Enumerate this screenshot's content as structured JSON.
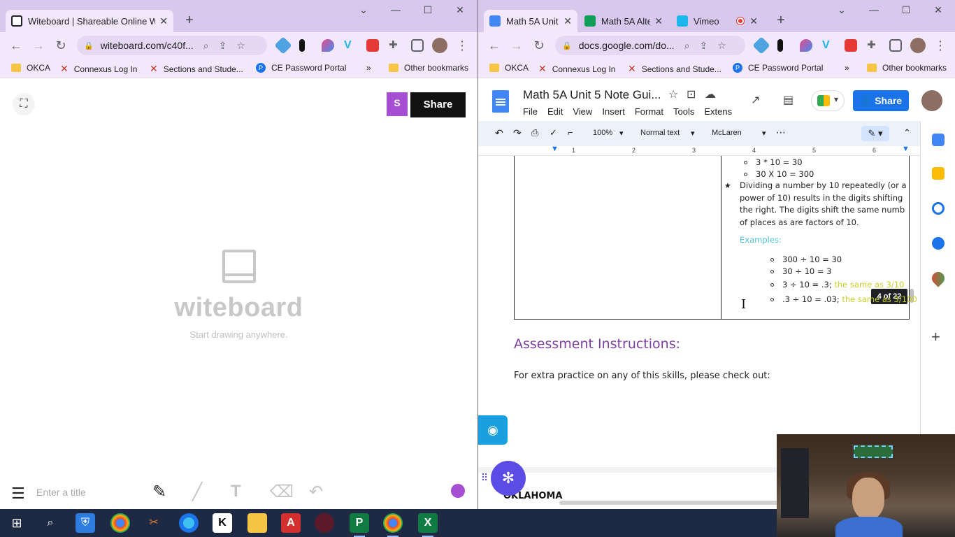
{
  "left_window": {
    "tab": {
      "title": "Witeboard | Shareable Online Wh",
      "close": "✕"
    },
    "new_tab": "+",
    "window_controls": {
      "chevron": "⌄",
      "minimize": "—",
      "maximize": "☐",
      "close": "✕"
    },
    "address": "witeboard.com/c40f...",
    "bookmarks": [
      "OKCA",
      "Connexus Log In",
      "Sections and Stude...",
      "CE Password Portal"
    ],
    "bookmarks_more": "»",
    "other_bookmarks": "Other bookmarks",
    "content": {
      "avatar_letter": "S",
      "share": "Share",
      "brand": "witeboard",
      "tagline": "Start drawing anywhere.",
      "title_placeholder": "Enter a title",
      "accent": "#a64fd2"
    }
  },
  "right_window": {
    "tabs": [
      {
        "title": "Math 5A Unit",
        "icon_color": "#4285f4"
      },
      {
        "title": "Math 5A Alte",
        "icon_color": "#0f9d58"
      },
      {
        "title": "Vimeo",
        "icon_color": "#1ab7ea"
      }
    ],
    "new_tab": "+",
    "window_controls": {
      "chevron": "⌄",
      "minimize": "—",
      "maximize": "☐",
      "close": "✕"
    },
    "address": "docs.google.com/do...",
    "bookmarks": [
      "OKCA",
      "Connexus Log In",
      "Sections and Stude...",
      "CE Password Portal"
    ],
    "bookmarks_more": "»",
    "other_bookmarks": "Other bookmarks",
    "doc": {
      "title": "Math 5A Unit 5 Note Gui...",
      "menu": [
        "File",
        "Edit",
        "View",
        "Insert",
        "Format",
        "Tools",
        "Extens"
      ],
      "share": "Share",
      "zoom": "100%",
      "style": "Normal text",
      "font": "McLaren",
      "ruler_marks": [
        "1",
        "2",
        "3",
        "4",
        "5",
        "6"
      ],
      "bullets_top": [
        "3 * 10 = 30",
        "30 X 10 = 300"
      ],
      "star_paragraph": [
        "Dividing a number by 10 repeatedly (or a",
        "power of 10) results in the digits shifting",
        "the right. The digits shift the same numb",
        "of places as are factors of 10."
      ],
      "examples_label": "Examples:",
      "examples": [
        {
          "text": "300 ÷ 10 = 30",
          "note": ""
        },
        {
          "text": "30 ÷ 10 = 3",
          "note": ""
        },
        {
          "text": "3 ÷ 10 = .3;",
          "note": "the same as 3/10"
        },
        {
          "text": ".3 ÷ 10 = .03;",
          "note": "the same as 3/100"
        }
      ],
      "page_count": "4 of 22",
      "assessment_heading": "Assessment Instructions:",
      "extra_practice": "For extra practice on any of this skills, please check out:",
      "footer_text": "OKLAHOMA"
    }
  }
}
